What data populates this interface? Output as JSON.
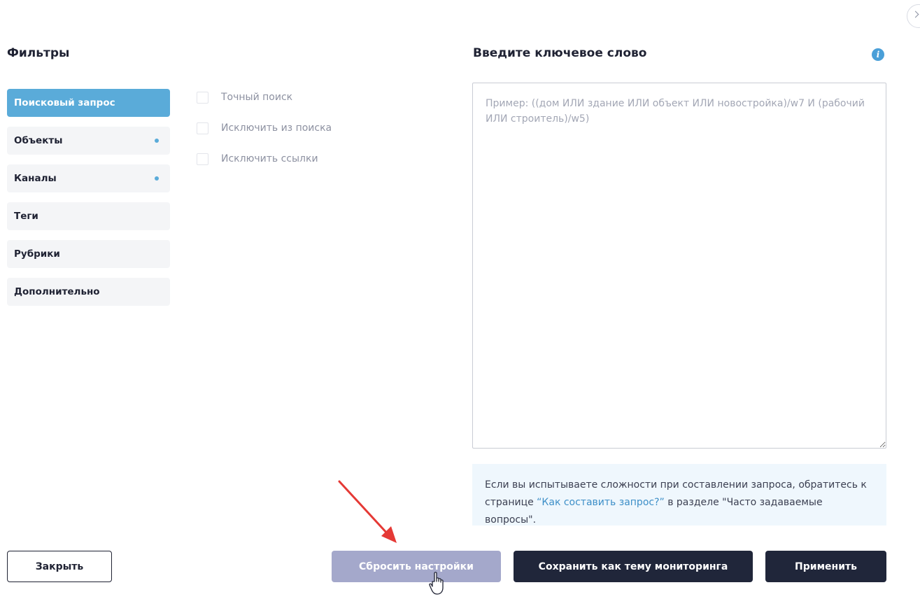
{
  "filters": {
    "title": "Фильтры",
    "items": [
      {
        "label": "Поисковый запрос",
        "active": true,
        "dot": false
      },
      {
        "label": "Объекты",
        "active": false,
        "dot": true
      },
      {
        "label": "Каналы",
        "active": false,
        "dot": true
      },
      {
        "label": "Теги",
        "active": false,
        "dot": false
      },
      {
        "label": "Рубрики",
        "active": false,
        "dot": false
      },
      {
        "label": "Дополнительно",
        "active": false,
        "dot": false
      }
    ]
  },
  "options": [
    {
      "label": "Точный поиск",
      "checked": false
    },
    {
      "label": "Исключить из поиска",
      "checked": false
    },
    {
      "label": "Исключить ссылки",
      "checked": false
    }
  ],
  "keyword": {
    "title": "Введите ключевое слово",
    "info_icon": "info-icon",
    "value": "",
    "placeholder": "Пример: ((дом ИЛИ здание ИЛИ объект ИЛИ новостройка)/w7 И (рабочий ИЛИ строитель)/w5)"
  },
  "help": {
    "text_before": "Если вы испытываете сложности при составлении запроса, обратитесь к странице ",
    "link_text": "“Как составить запрос?”",
    "text_after": " в разделе \"Часто задаваемые вопросы\"."
  },
  "buttons": {
    "close": "Закрыть",
    "reset": "Сбросить настройки",
    "save_topic": "Сохранить как тему мониторинга",
    "apply": "Применить"
  },
  "colors": {
    "accent": "#5aabd9",
    "dark_button": "#20263a",
    "disabled_button": "#a4a8cb",
    "annotation_arrow": "#e53935"
  }
}
